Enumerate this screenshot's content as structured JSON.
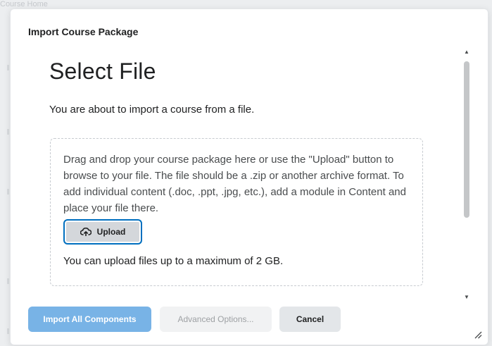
{
  "background": {
    "partial_text": "Course Home"
  },
  "dialog": {
    "title": "Import Course Package",
    "heading": "Select File",
    "intro": "You are about to import a course from a file.",
    "dropzone": {
      "instructions": "Drag and drop your course package here or use the \"Upload\" button to browse to your file. The file should be a .zip or another archive format. To add individual content (.doc, .ppt, .jpg, etc.), add a module in Content and place your file there.",
      "upload_label": "Upload",
      "upload_icon": "cloud-upload-icon",
      "limit_text": "You can upload files up to a maximum of 2 GB."
    },
    "footer": {
      "import_label": "Import All Components",
      "advanced_label": "Advanced Options...",
      "cancel_label": "Cancel"
    }
  },
  "colors": {
    "primary_button": "#78b3e6",
    "focus_ring": "#006fbf",
    "text": "#202122"
  }
}
